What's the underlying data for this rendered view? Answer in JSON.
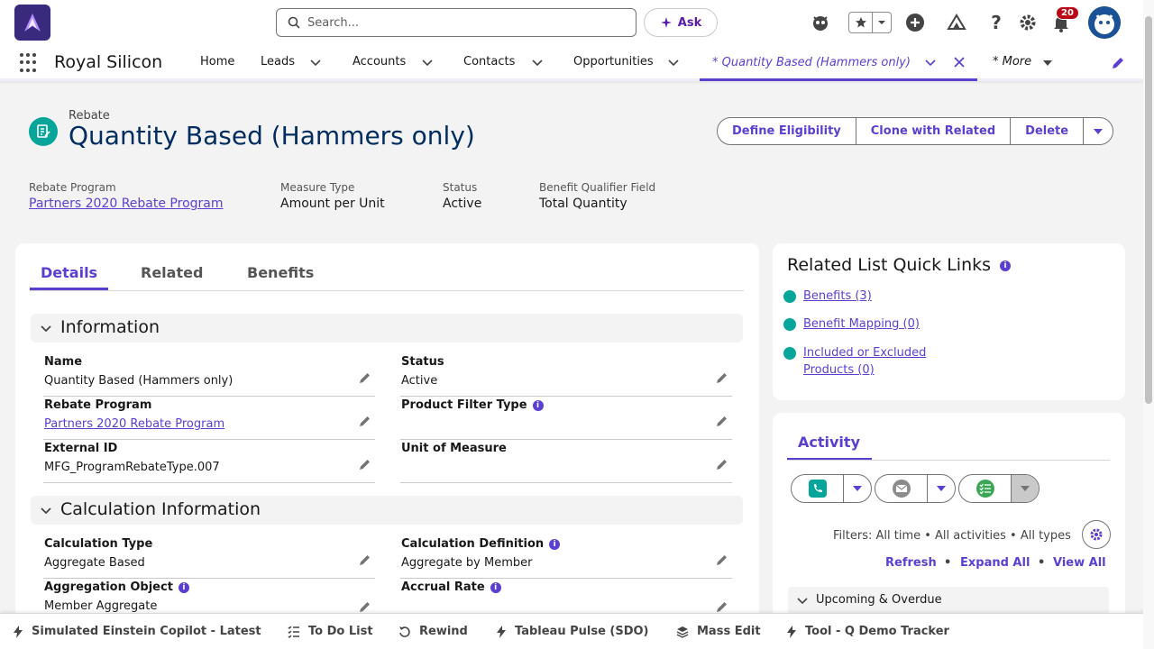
{
  "header": {
    "search_placeholder": "Search...",
    "ask_label": "Ask",
    "notification_count": "20"
  },
  "nav": {
    "app_name": "Royal Silicon",
    "items": [
      {
        "label": "Home"
      },
      {
        "label": "Leads"
      },
      {
        "label": "Accounts"
      },
      {
        "label": "Contacts"
      },
      {
        "label": "Opportunities"
      }
    ],
    "active_tab": "* Quantity Based (Hammers only)",
    "more": "* More"
  },
  "record": {
    "type": "Rebate",
    "title": "Quantity Based (Hammers only)",
    "actions": [
      "Define Eligibility",
      "Clone with Related",
      "Delete"
    ],
    "highlights": [
      {
        "label": "Rebate Program",
        "value": "Partners 2020 Rebate Program"
      },
      {
        "label": "Measure Type",
        "value": "Amount per Unit"
      },
      {
        "label": "Status",
        "value": "Active"
      },
      {
        "label": "Benefit Qualifier Field",
        "value": "Total Quantity"
      }
    ]
  },
  "tabs": [
    "Details",
    "Related",
    "Benefits"
  ],
  "sections": {
    "information": {
      "title": "Information",
      "fields": [
        {
          "label": "Name",
          "value": "Quantity Based (Hammers only)"
        },
        {
          "label": "Status",
          "value": "Active"
        },
        {
          "label": "Rebate Program",
          "value": "Partners 2020 Rebate Program"
        },
        {
          "label": "Product Filter Type",
          "value": ""
        },
        {
          "label": "External ID",
          "value": "MFG_ProgramRebateType.007"
        },
        {
          "label": "Unit of Measure",
          "value": ""
        }
      ]
    },
    "calculation": {
      "title": "Calculation Information",
      "fields": [
        {
          "label": "Calculation Type",
          "value": "Aggregate Based"
        },
        {
          "label": "Calculation Definition",
          "value": "Aggregate by Member"
        },
        {
          "label": "Aggregation Object",
          "value": "Member Aggregate"
        },
        {
          "label": "Accrual Rate",
          "value": ""
        }
      ]
    }
  },
  "quick_links": {
    "title": "Related List Quick Links",
    "links": [
      "Benefits (3)",
      "Benefit Mapping (0)",
      "Included or Excluded",
      "Products (0)"
    ]
  },
  "activity": {
    "tab": "Activity",
    "filters": "Filters: All time • All activities • All types",
    "links": [
      "Refresh",
      "Expand All",
      "View All"
    ],
    "upcoming": "Upcoming & Overdue"
  },
  "utility_bar": [
    "Simulated Einstein Copilot - Latest",
    "To Do List",
    "Rewind",
    "Tableau Pulse (SDO)",
    "Mass Edit",
    "Tool - Q Demo Tracker"
  ]
}
